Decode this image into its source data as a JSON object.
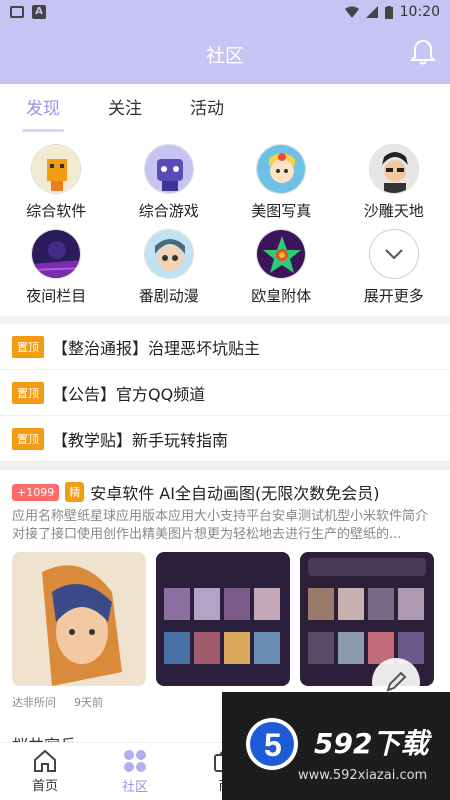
{
  "statusbar": {
    "time": "10:20"
  },
  "header": {
    "title": "社区"
  },
  "tabs": [
    {
      "label": "发现",
      "active": true
    },
    {
      "label": "关注",
      "active": false
    },
    {
      "label": "活动",
      "active": false
    }
  ],
  "categories": [
    {
      "label": "综合软件"
    },
    {
      "label": "综合游戏"
    },
    {
      "label": "美图写真"
    },
    {
      "label": "沙雕天地"
    },
    {
      "label": "夜间栏目"
    },
    {
      "label": "番剧动漫"
    },
    {
      "label": "欧皇附体"
    },
    {
      "label": "展开更多"
    }
  ],
  "pinned_tag": "置顶",
  "pinned": [
    {
      "text": "【整治通报】治理恶坏坑贴主"
    },
    {
      "text": "【公告】官方QQ频道"
    },
    {
      "text": "【教学贴】新手玩转指南"
    }
  ],
  "post": {
    "points": "+1099",
    "essence": "精",
    "title": "安卓软件 AI全自动画图(无限次数免会员)",
    "desc": "应用名称壁纸星球应用版本应用大小支持平台安卓测试机型小米软件简介对接了接口使用创作出精美图片想更为轻松地去进行生产的壁纸的...",
    "author": "达非所问",
    "time": "9天前"
  },
  "next_post_title": "桜井宿兵",
  "bottomnav": [
    {
      "label": "首页",
      "active": false
    },
    {
      "label": "社区",
      "active": true
    },
    {
      "label": "商",
      "active": false
    }
  ],
  "watermark": {
    "brand": "592下载",
    "url": "www.592xiazai.com"
  },
  "colors": {
    "header_bg": "#c7c4f3",
    "accent": "#9a93e6",
    "pin_tag": "#f39c12",
    "points_badge": "#ff6b6b"
  }
}
